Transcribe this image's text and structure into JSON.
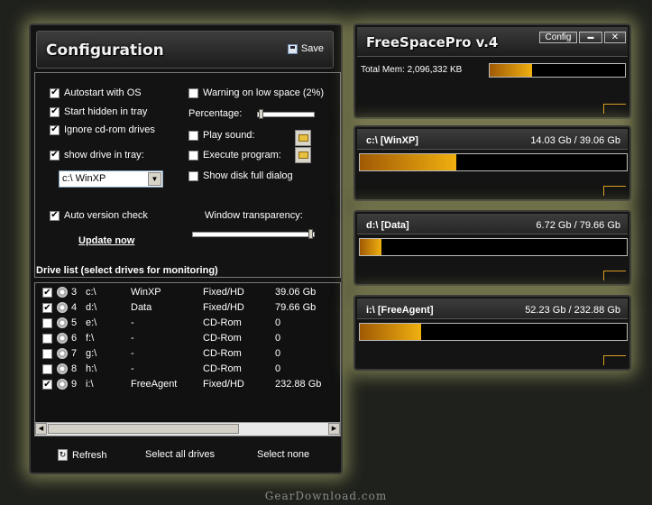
{
  "config": {
    "title": "Configuration",
    "save_label": "Save",
    "options_left": [
      {
        "label": "Autostart with OS",
        "checked": true
      },
      {
        "label": "Start hidden in tray",
        "checked": true
      },
      {
        "label": "Ignore cd-rom drives",
        "checked": true
      },
      {
        "label": "show drive in tray:",
        "checked": true
      }
    ],
    "tray_drive": "c:\\ WinXP",
    "auto_version_check": {
      "label": "Auto version check",
      "checked": true
    },
    "update_now": "Update now",
    "warning_low_space": {
      "label": "Warning on low space (2%)",
      "checked": false
    },
    "percentage_label": "Percentage:",
    "play_sound": {
      "label": "Play sound:",
      "checked": false
    },
    "execute_program": {
      "label": "Execute program:",
      "checked": false
    },
    "show_disk_full": {
      "label": "Show disk full dialog",
      "checked": false
    },
    "transparency_label": "Window transparency:",
    "transparency_value": 1.0,
    "drive_list_title": "Drive list (select drives for monitoring)",
    "drives": [
      {
        "checked": true,
        "num": "3",
        "letter": "c:\\",
        "label": "WinXP",
        "type": "Fixed/HD",
        "size": "39.06 Gb"
      },
      {
        "checked": true,
        "num": "4",
        "letter": "d:\\",
        "label": "Data",
        "type": "Fixed/HD",
        "size": "79.66 Gb"
      },
      {
        "checked": false,
        "num": "5",
        "letter": "e:\\",
        "label": "-",
        "type": "CD-Rom",
        "size": "0"
      },
      {
        "checked": false,
        "num": "6",
        "letter": "f:\\",
        "label": "-",
        "type": "CD-Rom",
        "size": "0"
      },
      {
        "checked": false,
        "num": "7",
        "letter": "g:\\",
        "label": "-",
        "type": "CD-Rom",
        "size": "0"
      },
      {
        "checked": false,
        "num": "8",
        "letter": "h:\\",
        "label": "-",
        "type": "CD-Rom",
        "size": "0"
      },
      {
        "checked": true,
        "num": "9",
        "letter": "i:\\",
        "label": "FreeAgent",
        "type": "Fixed/HD",
        "size": "232.88 Gb"
      }
    ],
    "refresh_label": "Refresh",
    "select_all_label": "Select all drives",
    "select_none_label": "Select none"
  },
  "fsp": {
    "title": "FreeSpacePro v.4",
    "config_btn": "Config",
    "min_btn": "▬",
    "close_btn": "✕",
    "total_mem_label": "Total Mem: 2,096,332 KB",
    "total_mem_fill": 0.31
  },
  "drive_panels": [
    {
      "name": "c:\\ [WinXP]",
      "usage": "14.03 Gb / 39.06 Gb",
      "fill": 0.36
    },
    {
      "name": "d:\\ [Data]",
      "usage": "6.72 Gb / 79.66 Gb",
      "fill": 0.08
    },
    {
      "name": "i:\\ [FreeAgent]",
      "usage": "52.23 Gb / 232.88 Gb",
      "fill": 0.23
    }
  ],
  "watermark": "GearDownload.com"
}
